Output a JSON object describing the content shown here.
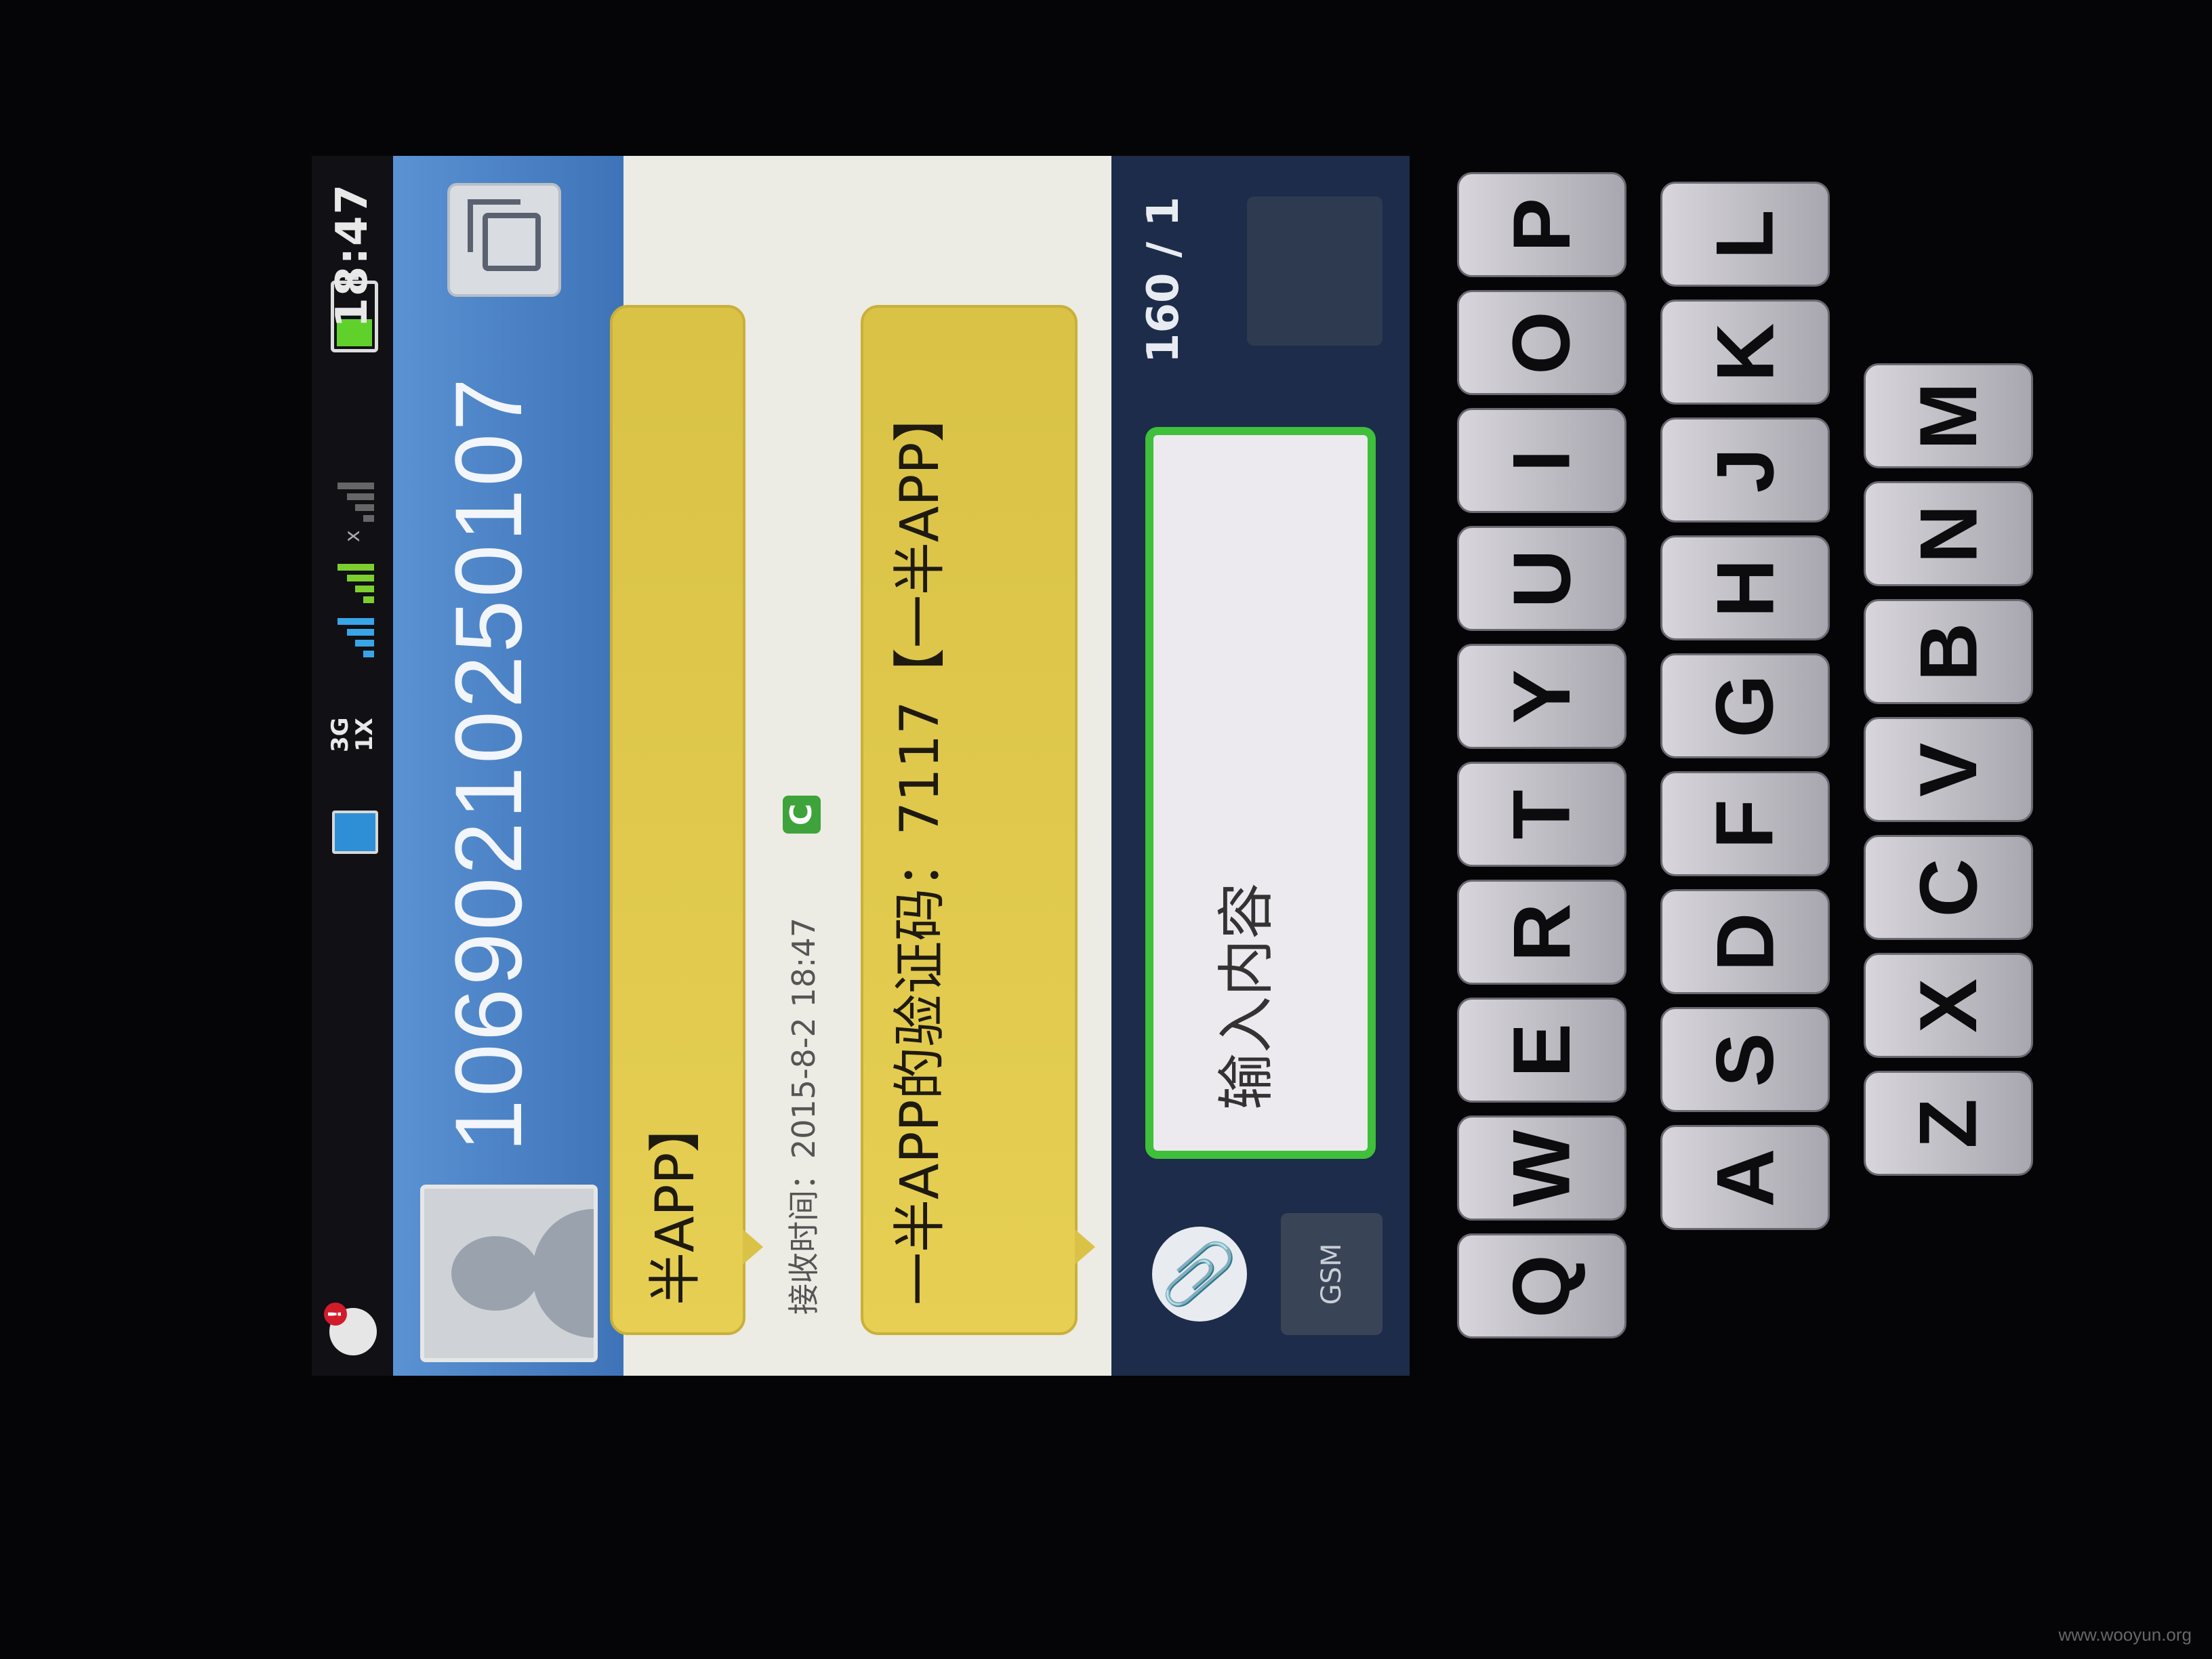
{
  "status_bar": {
    "time": "18:47",
    "network_3g": "3G",
    "network_1x": "1X",
    "signal_x": "x"
  },
  "header": {
    "contact_number": "1069021025​0107"
  },
  "messages": [
    {
      "text": "半APP】"
    },
    {
      "received_time": "接收时间：2015-8-2  18:47",
      "badge": "C"
    },
    {
      "text": "一半APP的验证码：7117【一半APP】"
    }
  ],
  "compose": {
    "placeholder": "输入内容",
    "char_count": "160 / 1",
    "sim_label": "GSM"
  },
  "keyboard": {
    "row1": [
      "Q",
      "W",
      "E",
      "R",
      "T",
      "Y",
      "U",
      "I",
      "O",
      "P"
    ],
    "row2": [
      "A",
      "S",
      "D",
      "F",
      "G",
      "H",
      "J",
      "K",
      "L"
    ],
    "row3": [
      "Z",
      "X",
      "C",
      "V",
      "B",
      "N",
      "M"
    ]
  },
  "watermark": "www.wooyun.org",
  "colors": {
    "header_blue": "#4a80c4",
    "bubble_yellow": "#dfc84c",
    "input_border_green": "#3fbf3a"
  }
}
